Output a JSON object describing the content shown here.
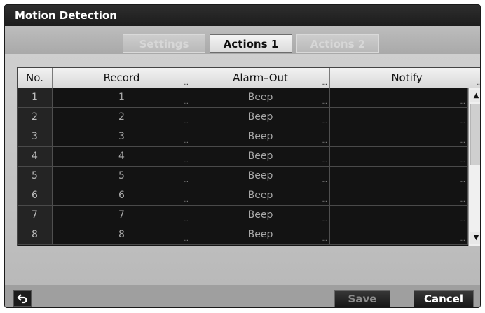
{
  "window": {
    "title": "Motion Detection"
  },
  "tabs": [
    {
      "label": "Settings"
    },
    {
      "label": "Actions 1"
    },
    {
      "label": "Actions 2"
    }
  ],
  "table": {
    "headers": [
      "No.",
      "Record",
      "Alarm–Out",
      "Notify"
    ],
    "rows": [
      [
        "1",
        "1",
        "Beep",
        ""
      ],
      [
        "2",
        "2",
        "Beep",
        ""
      ],
      [
        "3",
        "3",
        "Beep",
        ""
      ],
      [
        "4",
        "4",
        "Beep",
        ""
      ],
      [
        "5",
        "5",
        "Beep",
        ""
      ],
      [
        "6",
        "6",
        "Beep",
        ""
      ],
      [
        "7",
        "7",
        "Beep",
        ""
      ],
      [
        "8",
        "8",
        "Beep",
        ""
      ]
    ],
    "ellipsis": "..."
  },
  "buttons": {
    "save": "Save",
    "cancel": "Cancel"
  },
  "icons": {
    "back": "back-arrow-icon",
    "scroll_up": "up-arrow-icon",
    "scroll_down": "down-arrow-icon"
  }
}
